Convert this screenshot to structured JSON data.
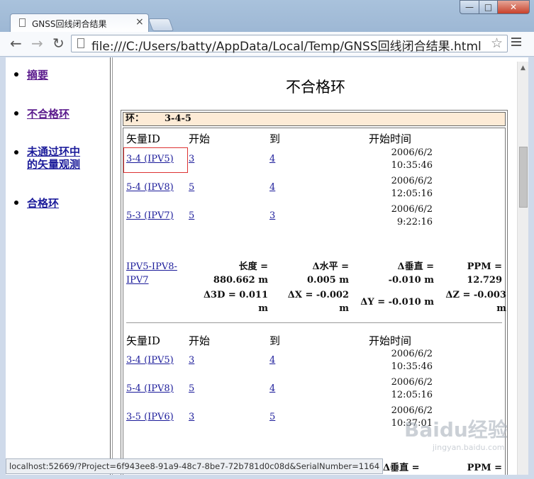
{
  "browser": {
    "tab_title": "GNSS回线闭合结果",
    "tab_close": "×",
    "url": "file:///C:/Users/batty/AppData/Local/Temp/GNSS回线闭合结果.html",
    "status_url": "localhost:52669/?Project=6f943ee8-91a9-48c7-8be7-72b781d0c08d&SerialNumber=1164",
    "window_buttons": {
      "minimize": "—",
      "maximize": "□",
      "close": "✕"
    },
    "nav_icons": {
      "back": "←",
      "forward": "→",
      "reload": "↻",
      "star": "☆"
    }
  },
  "sidebar": {
    "items": [
      {
        "label": "摘要",
        "visited": true
      },
      {
        "label": "不合格环",
        "visited": true
      },
      {
        "label": "未通过环中的矢量观测",
        "visited": false
      },
      {
        "label": "合格环",
        "visited": false
      }
    ]
  },
  "main": {
    "heading": "不合格环",
    "ring_label": "环：",
    "ring_value": "3-4-5",
    "columns": [
      "矢量ID",
      "开始",
      "到",
      "开始时间"
    ],
    "group1": [
      {
        "id": "3-4 (IPV5)",
        "start": "3",
        "end": "4",
        "date": "2006/6/2",
        "time": "10:35:46"
      },
      {
        "id": "5-4 (IPV8)",
        "start": "5",
        "end": "4",
        "date": "2006/6/2",
        "time": "12:05:16"
      },
      {
        "id": "5-3 (IPV7)",
        "start": "5",
        "end": "3",
        "date": "2006/6/2",
        "time": "9:22:16"
      }
    ],
    "closure": {
      "link": "IPV5-IPV8-IPV7",
      "length": "长度 = 880.662 m",
      "horizontal": "Δ水平 = 0.005 m",
      "vertical": "Δ垂直 = -0.010 m",
      "ppm": "PPM = 12.729",
      "d3d": "Δ3D = 0.011 m",
      "dx": "ΔX = -0.002 m",
      "dy": "ΔY = -0.010 m",
      "dz": "ΔZ = -0.003 m"
    },
    "group2": [
      {
        "id": "3-4 (IPV5)",
        "start": "3",
        "end": "4",
        "date": "2006/6/2",
        "time": "10:35:46"
      },
      {
        "id": "5-4 (IPV8)",
        "start": "5",
        "end": "4",
        "date": "2006/6/2",
        "time": "12:05:16"
      },
      {
        "id": "3-5 (IPV6)",
        "start": "3",
        "end": "5",
        "date": "2006/6/2",
        "time": "10:37:01"
      }
    ],
    "partial": {
      "vertical": "Δ垂直 =",
      "ppm": "PPM ="
    }
  },
  "watermark": {
    "text": "Baidu经验",
    "sub": "jingyan.baidu.com"
  }
}
